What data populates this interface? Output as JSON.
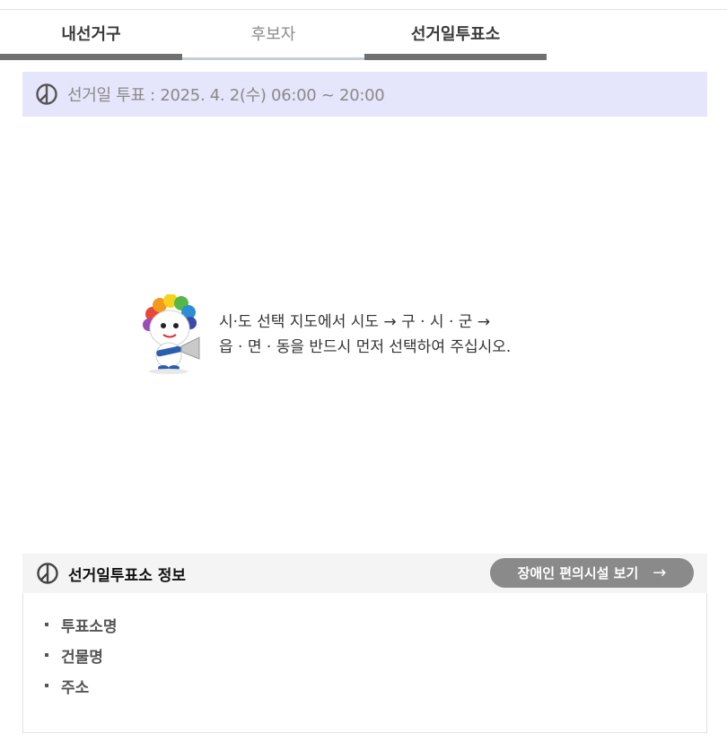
{
  "tabs": [
    {
      "label": "내선거구",
      "state": "active"
    },
    {
      "label": "후보자",
      "state": "inactive"
    },
    {
      "label": "선거일투표소",
      "state": "active"
    }
  ],
  "date_bar": {
    "icon": "ballot-icon",
    "label": "선거일 투표 : 2025. 4. 2(수) 06:00 ~ 20:00"
  },
  "notice": {
    "icon": "election-mascot",
    "line1": "시·도 선택 지도에서 시도 → 구 · 시 · 군 →",
    "line2": "읍 · 면 · 동을 반드시 먼저 선택하여 주십시오."
  },
  "info": {
    "icon": "ballot-icon",
    "title": "선거일투표소 정보",
    "button_label": "장애인 편의시설 보기",
    "button_icon": "arrow-right-icon",
    "items": [
      "투표소명",
      "건물명",
      "주소"
    ]
  },
  "colors": {
    "tab_active_border": "#707070",
    "tab_inactive_border": "#c5cdd9",
    "date_bar_bg": "#e5e5fb",
    "info_header_bg": "#f4f4f4",
    "button_bg": "#8a8a8a"
  }
}
